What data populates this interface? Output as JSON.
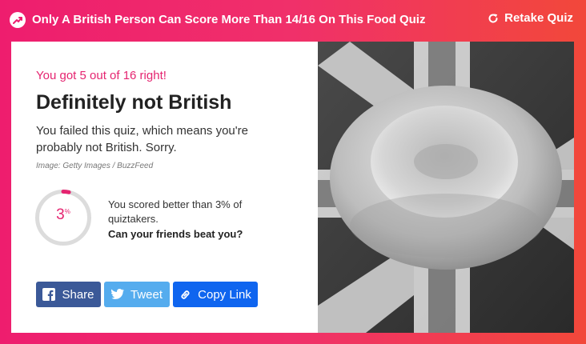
{
  "topbar": {
    "quiz_title": "Only A British Person Can Score More Than 14/16 On This Food Quiz",
    "retake_label": "Retake Quiz",
    "trending_icon": "trending-arrow-icon",
    "retake_icon": "refresh-icon"
  },
  "result": {
    "score_line": "You got 5 out of 16 right!",
    "title": "Definitely not British",
    "description": "You failed this quiz, which means you're probably not British. Sorry.",
    "image_credit": "Image: Getty Images / BuzzFeed",
    "percentile": "3",
    "percentile_unit": "%",
    "percentile_fraction": 0.03,
    "stat_text": "You scored better than 3% of quiztakers.",
    "challenge_text": "Can your friends beat you?",
    "photo_alt": "Yorkshire pudding on a Union Jack flag"
  },
  "share": {
    "facebook_label": "Share",
    "twitter_label": "Tweet",
    "copy_link_label": "Copy Link"
  },
  "colors": {
    "accent": "#e52470",
    "facebook": "#3b5998",
    "twitter": "#55acee",
    "copy_link": "#0f65ef",
    "gauge_track": "#dcdcdc"
  }
}
